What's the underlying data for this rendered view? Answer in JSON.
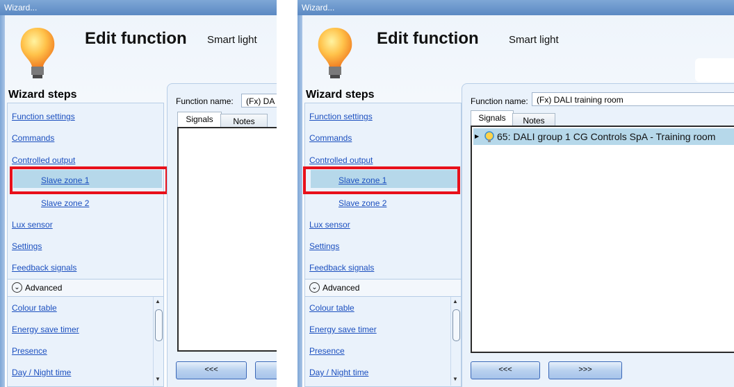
{
  "window": {
    "title": "Wizard..."
  },
  "header": {
    "title": "Edit function",
    "subtitle": "Smart light"
  },
  "steps": {
    "title": "Wizard steps",
    "items": [
      {
        "label": "Function settings"
      },
      {
        "label": "Commands"
      },
      {
        "label": "Controlled output"
      },
      {
        "label": "Slave zone 1"
      },
      {
        "label": "Slave zone 2"
      },
      {
        "label": "Lux sensor"
      },
      {
        "label": "Settings"
      },
      {
        "label": "Feedback signals"
      }
    ],
    "advanced_label": "Advanced",
    "advanced_items": [
      {
        "label": "Colour table"
      },
      {
        "label": "Energy save timer"
      },
      {
        "label": "Presence"
      },
      {
        "label": "Day / Night time"
      }
    ],
    "selected": "Slave zone 1"
  },
  "function": {
    "name_label": "Function name:",
    "name_left": "(Fx) DA",
    "name_right": "(Fx) DALI training room"
  },
  "tabs": {
    "signals": "Signals",
    "notes": "Notes"
  },
  "signals": {
    "right_row": "65: DALI group 1 CG Controls SpA - Training room"
  },
  "nav": {
    "prev": "<<<",
    "next": ">>>"
  },
  "colors": {
    "highlight": "#e8101a",
    "selection": "#b6d8ea",
    "link": "#1b4fbf"
  }
}
